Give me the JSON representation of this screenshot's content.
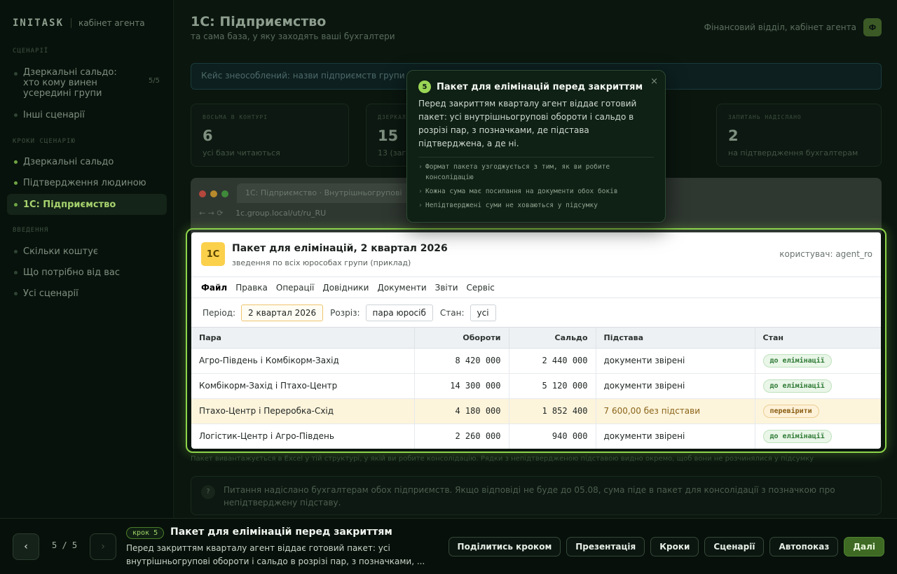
{
  "sidebar": {
    "brand": "INITASK",
    "brand_sub": "кабінет агента",
    "section_scenarios": "СЦЕНАРІЇ",
    "scenario_current": "Дзеркальні сальдо: хто кому винен усередині групи",
    "scenario_count": "5/5",
    "scenario_other": "Інші сценарії",
    "section_steps": "КРОКИ СЦЕНАРІЮ",
    "steps": [
      "Дзеркальні сальдо",
      "Підтвердження людиною",
      "1С: Підприємство"
    ],
    "section_intro": "ВВЕДЕННЯ",
    "intro": [
      "Скільки коштує",
      "Що потрібно від вас",
      "Усі сценарії"
    ]
  },
  "main": {
    "title": "1С: Підприємство",
    "subtitle": "та сама база, у яку заходять ваші бухгалтери",
    "dept": "Фінансовий відділ, кабінет агента",
    "avatar": "Ф",
    "notice": "Кейс знеособлений: назви підприємств групи ... справжні.",
    "stats": [
      {
        "label": "ВОСЬМА В КОНТУРІ",
        "value": "6",
        "sub": "усі бази читаються"
      },
      {
        "label": "ДЗЕРКАЛЬНИХ ПАР",
        "value": "15",
        "sub": "13 (зага..."
      },
      {
        "label": "ЗАПИТАНЬ НАДІСЛАНО",
        "value": "2",
        "sub": "на підтвердження бухгалтерам"
      }
    ],
    "window_tab": "1С: Підприємство · Внутрішньогрупові",
    "window_url": "1c.group.local/ut/ru_RU",
    "bottom_note": "Пакет вивантажується в Excel у тій структурі, у якій ви робите консолідацію. Рядки з непідтвердженою підставою видно окремо, щоб вони не розчинялися у підсумку",
    "answer": "Питання надіслано бухгалтерам обох підприємств. Якщо відповіді не буде до 05.08, сума піде в пакет для консолідації з позначкою про непідтверджену підставу."
  },
  "onec": {
    "logo": "1С",
    "title": "Пакет для елімінацій, 2 квартал 2026",
    "subtitle": "зведення по всіх юрособах групи (приклад)",
    "user": "користувач: agent_ro",
    "menu": [
      "Файл",
      "Правка",
      "Операції",
      "Довідники",
      "Документи",
      "Звіти",
      "Сервіс"
    ],
    "filters": {
      "period_label": "Період:",
      "period_value": "2 квартал 2026",
      "slice_label": "Розріз:",
      "slice_value": "пара юросіб",
      "state_label": "Стан:",
      "state_value": "усі"
    },
    "columns": [
      "Пара",
      "Обороти",
      "Сальдо",
      "Підстава",
      "Стан"
    ],
    "rows": [
      {
        "pair": "Агро-Південь і Комбікорм-Захід",
        "turnover": "8 420 000",
        "balance": "2 440 000",
        "basis": "документи звірені",
        "state": "до елімінації"
      },
      {
        "pair": "Комбікорм-Захід і Птахо-Центр",
        "turnover": "14 300 000",
        "balance": "5 120 000",
        "basis": "документи звірені",
        "state": "до елімінації"
      },
      {
        "pair": "Птахо-Центр і Переробка-Схід",
        "turnover": "4 180 000",
        "balance": "1 852 400",
        "basis": "7 600,00 без підстави",
        "state": "перевірити"
      },
      {
        "pair": "Логістик-Центр і Агро-Південь",
        "turnover": "2 260 000",
        "balance": "940 000",
        "basis": "документи звірені",
        "state": "до елімінації"
      }
    ]
  },
  "tooltip": {
    "num": "5",
    "title": "Пакет для елімінацій перед закриттям",
    "close": "×",
    "body": "Перед закриттям кварталу агент віддає готовий пакет: усі внутрішньогрупові обороти і сальдо в розрізі пар, з позначками, де підстава підтверджена, а де ні.",
    "points": [
      "Формат пакета узгоджується з тим, як ви робите консолідацію",
      "Кожна сума має посилання на документи обох боків",
      "Непідтверджені суми не ховаються у підсумку"
    ]
  },
  "bar": {
    "prev": "‹",
    "next": "›",
    "counter": "5 / 5",
    "step_pill": "крок 5",
    "step_title": "Пакет для елімінацій перед закриттям",
    "step_desc": "Перед закриттям кварталу агент віддає готовий пакет: усі внутрішньогрупові обороти і сальдо в розрізі пар, з позначками, ...",
    "actions": [
      "Поділитись кроком",
      "Презентація",
      "Кроки",
      "Сценарії",
      "Автопоказ",
      "Далі"
    ]
  }
}
